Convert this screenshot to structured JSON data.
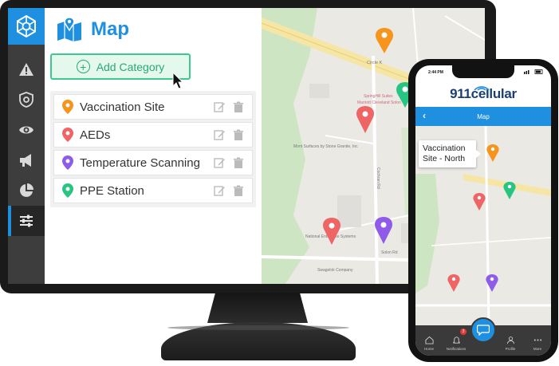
{
  "app": {
    "page_title": "Map",
    "add_button_label": "Add Category"
  },
  "sidebar": {
    "items": [
      {
        "icon": "warning-icon"
      },
      {
        "icon": "shield-gear-icon"
      },
      {
        "icon": "eye-icon"
      },
      {
        "icon": "megaphone-icon"
      },
      {
        "icon": "pie-chart-icon"
      },
      {
        "icon": "sliders-icon",
        "active": true
      }
    ]
  },
  "categories": [
    {
      "label": "Vaccination Site",
      "color": "#f7941d"
    },
    {
      "label": "AEDs",
      "color": "#ef6464"
    },
    {
      "label": "Temperature Scanning",
      "color": "#8e5ce8"
    },
    {
      "label": "PPE Station",
      "color": "#27c482"
    }
  ],
  "map": {
    "labels": {
      "circle": "Circle K",
      "springhill": "SpringHill Suites",
      "marriott": "Marriott Cleveland Solon",
      "surfaces": "Mont Surfaces by Stone Granite, Inc",
      "cochran": "Cochran Rd",
      "national": "National Enterprise Systems",
      "solon": "Solon Rd",
      "swagelok": "Swagelok Company"
    }
  },
  "phone": {
    "time": "2:44 PM",
    "brand": "911cellular",
    "nav_title": "Map",
    "callout_text": "Vaccination Site - North",
    "notification_count": "3",
    "tabs": [
      {
        "label": "Home",
        "icon": "home-icon"
      },
      {
        "label": "Notifications",
        "icon": "bell-icon"
      },
      {
        "label": "",
        "icon": "chat-icon"
      },
      {
        "label": "Profile",
        "icon": "person-icon"
      },
      {
        "label": "More",
        "icon": "more-icon"
      }
    ]
  },
  "colors": {
    "accent": "#1f8fe0",
    "green": "#27c482",
    "orange": "#f7941d",
    "red": "#ef6464",
    "purple": "#8e5ce8"
  }
}
